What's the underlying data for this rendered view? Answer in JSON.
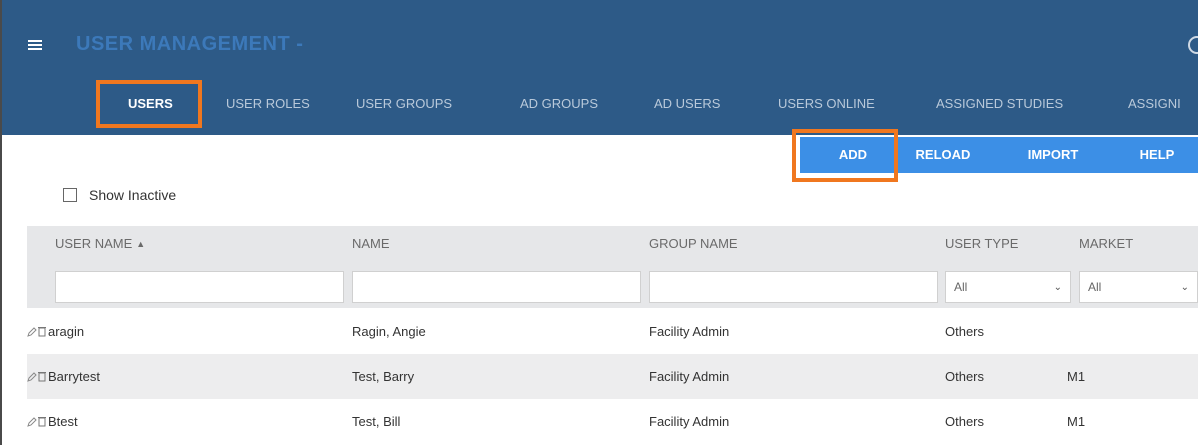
{
  "app": {
    "title": "USER MANAGEMENT -"
  },
  "tabs": [
    {
      "label": "USERS",
      "active": true
    },
    {
      "label": "USER ROLES"
    },
    {
      "label": "USER GROUPS"
    },
    {
      "label": "AD GROUPS"
    },
    {
      "label": "AD USERS"
    },
    {
      "label": "USERS ONLINE"
    },
    {
      "label": "ASSIGNED STUDIES"
    },
    {
      "label": "ASSIGNI"
    }
  ],
  "actions": {
    "add": "ADD",
    "reload": "RELOAD",
    "import": "IMPORT",
    "help": "HELP"
  },
  "filters": {
    "show_inactive_label": "Show Inactive",
    "show_inactive_checked": false
  },
  "table": {
    "columns": {
      "user_name": "USER NAME",
      "name": "NAME",
      "group_name": "GROUP NAME",
      "user_type": "USER TYPE",
      "market": "MARKET"
    },
    "sort_icon": "sort-ascending-icon",
    "filter_values": {
      "user_type": "All",
      "market": "All"
    },
    "rows": [
      {
        "user_name": "aragin",
        "name": "Ragin, Angie",
        "group_name": "Facility Admin",
        "user_type": "Others",
        "market": ""
      },
      {
        "user_name": "Barrytest",
        "name": "Test, Barry",
        "group_name": "Facility Admin",
        "user_type": "Others",
        "market": "M1"
      },
      {
        "user_name": "Btest",
        "name": "Test, Bill",
        "group_name": "Facility Admin",
        "user_type": "Others",
        "market": "M1"
      }
    ]
  },
  "colors": {
    "header_bg": "#2d5a87",
    "action_bar": "#3c8fe6",
    "highlight": "#f0771f",
    "row_alt": "#ededee"
  }
}
